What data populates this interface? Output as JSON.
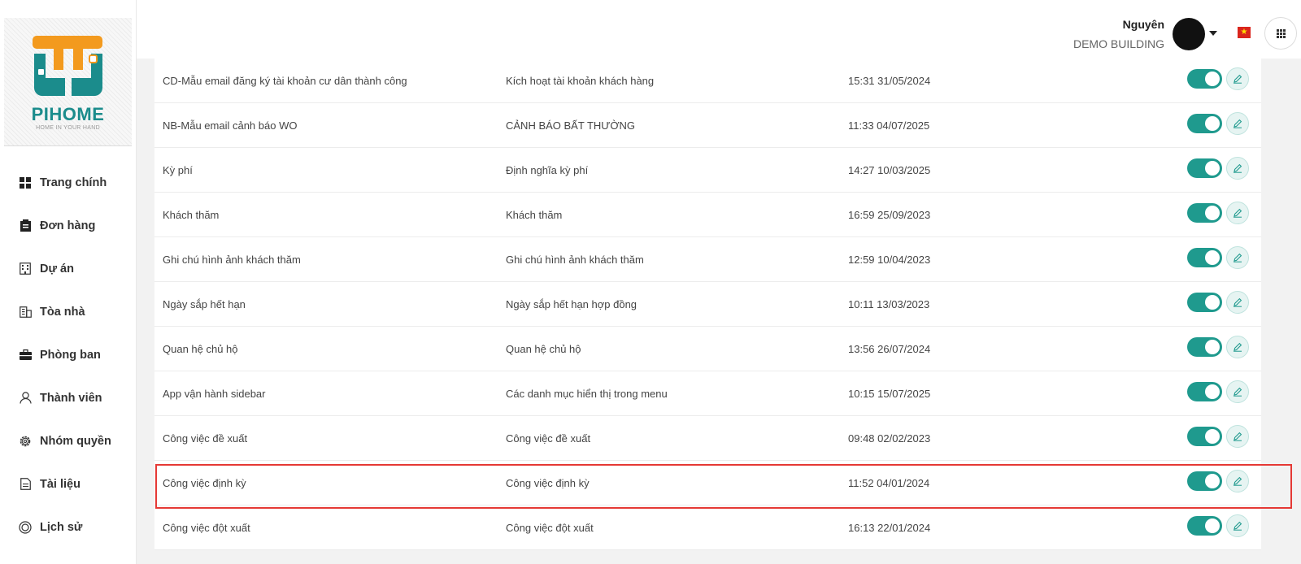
{
  "logo": {
    "name": "PIHOME",
    "tagline": "HOME IN YOUR HAND"
  },
  "sidebar": {
    "items": [
      {
        "label": "Trang chính",
        "icon": "grid-icon"
      },
      {
        "label": "Đơn hàng",
        "icon": "clipboard-icon"
      },
      {
        "label": "Dự án",
        "icon": "building-icon"
      },
      {
        "label": "Tòa nhà",
        "icon": "office-building-icon"
      },
      {
        "label": "Phòng ban",
        "icon": "briefcase-icon"
      },
      {
        "label": "Thành viên",
        "icon": "user-icon"
      },
      {
        "label": "Nhóm quyền",
        "icon": "gear-icon"
      },
      {
        "label": "Tài liệu",
        "icon": "document-icon"
      },
      {
        "label": "Lịch sử",
        "icon": "history-icon"
      }
    ]
  },
  "header": {
    "user_name": "Nguyên",
    "organization": "DEMO BUILDING"
  },
  "rows": [
    {
      "name": "CD-Mẫu email đăng ký tài khoản cư dân thành công",
      "description": "Kích hoạt tài khoản khách hàng",
      "updated": "15:31 31/05/2024",
      "enabled": true
    },
    {
      "name": "NB-Mẫu email cảnh báo WO",
      "description": "CẢNH BÁO BẤT THƯỜNG",
      "updated": "11:33 04/07/2025",
      "enabled": true
    },
    {
      "name": "Kỳ phí",
      "description": "Định nghĩa kỳ phí",
      "updated": "14:27 10/03/2025",
      "enabled": true
    },
    {
      "name": "Khách thăm",
      "description": "Khách thăm",
      "updated": "16:59 25/09/2023",
      "enabled": true
    },
    {
      "name": "Ghi chú hình ảnh khách thăm",
      "description": "Ghi chú hình ảnh khách thăm",
      "updated": "12:59 10/04/2023",
      "enabled": true
    },
    {
      "name": "Ngày sắp hết hạn",
      "description": "Ngày sắp hết hạn hợp đồng",
      "updated": "10:11 13/03/2023",
      "enabled": true
    },
    {
      "name": "Quan hệ chủ hộ",
      "description": "Quan hệ chủ hộ",
      "updated": "13:56 26/07/2024",
      "enabled": true
    },
    {
      "name": "App vận hành sidebar",
      "description": "Các danh mục hiển thị trong menu",
      "updated": "10:15 15/07/2025",
      "enabled": true
    },
    {
      "name": "Công việc đề xuất",
      "description": "Công việc đề xuất",
      "updated": "09:48 02/02/2023",
      "enabled": true
    },
    {
      "name": "Công việc định kỳ",
      "description": "Công việc định kỳ",
      "updated": "11:52 04/01/2024",
      "enabled": true
    },
    {
      "name": "Công việc đột xuất",
      "description": "Công việc đột xuất",
      "updated": "16:13 22/01/2024",
      "enabled": true
    }
  ],
  "colors": {
    "accent": "#1f9a8e",
    "highlight": "#e53935",
    "logo_orange": "#f39a1e",
    "logo_teal": "#1b8c8c"
  }
}
